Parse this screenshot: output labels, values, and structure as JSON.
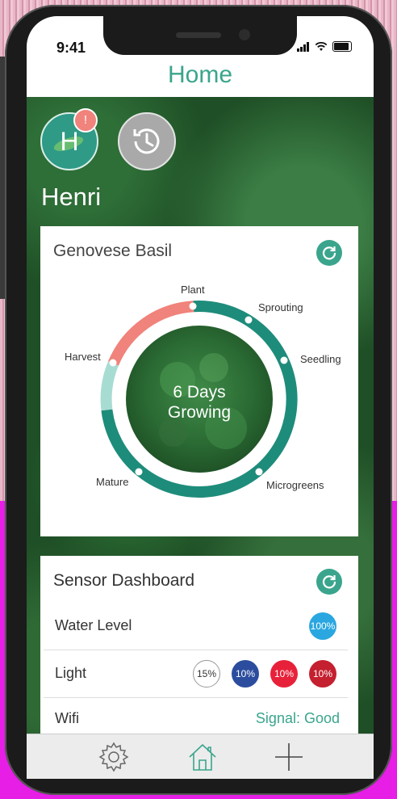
{
  "status": {
    "time": "9:41"
  },
  "header": {
    "title": "Home"
  },
  "user": {
    "initial": "H",
    "name": "Henri",
    "alert": "!"
  },
  "plant": {
    "name": "Genovese Basil",
    "center_line1": "6 Days",
    "center_line2": "Growing",
    "stages": [
      "Plant",
      "Sprouting",
      "Seedling",
      "Microgreens",
      "Mature",
      "Harvest"
    ]
  },
  "sensors": {
    "title": "Sensor Dashboard",
    "water": {
      "label": "Water Level",
      "value": "100%"
    },
    "light": {
      "label": "Light",
      "values": [
        "15%",
        "10%",
        "10%",
        "10%"
      ]
    },
    "wifi": {
      "label": "Wifi",
      "status": "Signal: Good"
    }
  },
  "colors": {
    "accent": "#3aa58c",
    "ring_main": "#1e8c7b",
    "ring_harvest": "#f0837b",
    "ring_light": "#a7dcd3",
    "water": "#2aa7e0",
    "light_blue": "#2c4d9e",
    "light_red": "#e8213a",
    "light_darkred": "#c4202f"
  },
  "icons": [
    "settings-gear-icon",
    "home-icon",
    "plus-icon",
    "history-icon",
    "refresh-icon"
  ]
}
